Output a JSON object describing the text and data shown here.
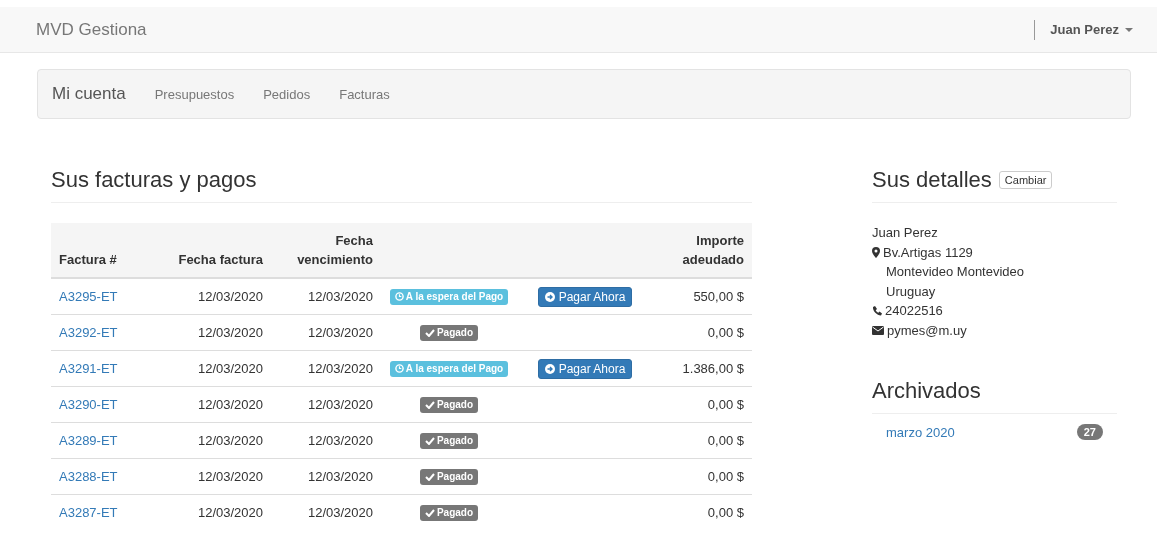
{
  "navbar": {
    "brand": "MVD Gestiona",
    "user": "Juan Perez"
  },
  "account_nav": {
    "title": "Mi cuenta",
    "links": [
      "Presupuestos",
      "Pedidos",
      "Facturas"
    ]
  },
  "invoices": {
    "title": "Sus facturas y pagos",
    "columns": [
      "Factura #",
      "Fecha factura",
      "Fecha vencimiento",
      "Importe adeudado"
    ],
    "rows": [
      {
        "number": "A3295-ET",
        "date": "12/03/2020",
        "due": "12/03/2020",
        "status": "A la espera del Pago",
        "kind": "pending",
        "pay_button": "Pagar Ahora",
        "amount": "550,00 $"
      },
      {
        "number": "A3292-ET",
        "date": "12/03/2020",
        "due": "12/03/2020",
        "status": "Pagado",
        "kind": "paid",
        "amount": "0,00 $"
      },
      {
        "number": "A3291-ET",
        "date": "12/03/2020",
        "due": "12/03/2020",
        "status": "A la espera del Pago",
        "kind": "pending",
        "pay_button": "Pagar Ahora",
        "amount": "1.386,00 $"
      },
      {
        "number": "A3290-ET",
        "date": "12/03/2020",
        "due": "12/03/2020",
        "status": "Pagado",
        "kind": "paid",
        "amount": "0,00 $"
      },
      {
        "number": "A3289-ET",
        "date": "12/03/2020",
        "due": "12/03/2020",
        "status": "Pagado",
        "kind": "paid",
        "amount": "0,00 $"
      },
      {
        "number": "A3288-ET",
        "date": "12/03/2020",
        "due": "12/03/2020",
        "status": "Pagado",
        "kind": "paid",
        "amount": "0,00 $"
      },
      {
        "number": "A3287-ET",
        "date": "12/03/2020",
        "due": "12/03/2020",
        "status": "Pagado",
        "kind": "paid",
        "amount": "0,00 $"
      }
    ]
  },
  "details": {
    "title": "Sus detalles",
    "change_button": "Cambiar",
    "name": "Juan Perez",
    "address": [
      "Bv.Artigas 1129",
      "Montevideo Montevideo",
      "Uruguay"
    ],
    "phone": "24022516",
    "email": "pymes@m.uy"
  },
  "archive": {
    "title": "Archivados",
    "items": [
      {
        "label": "marzo 2020",
        "count": "27"
      }
    ]
  }
}
